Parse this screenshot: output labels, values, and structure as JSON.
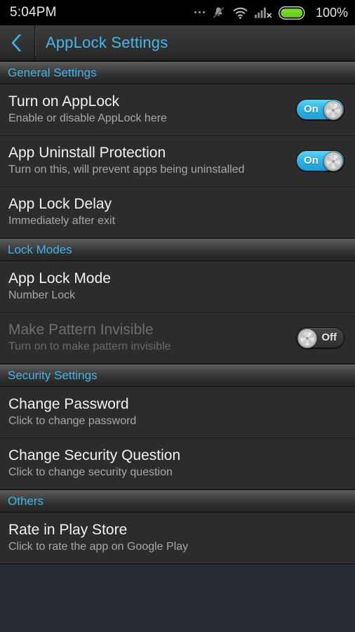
{
  "status_bar": {
    "time": "5:04PM",
    "overflow_dots": "...",
    "icons": [
      "vibrate-off-icon",
      "wifi-icon",
      "signal-no-service-icon",
      "battery-icon"
    ],
    "battery_percent": "100%",
    "battery_color": "#6ad020"
  },
  "title_bar": {
    "back_label": "‹",
    "title": "AppLock Settings",
    "accent_color": "#49b6e8"
  },
  "sections": [
    {
      "header": "General Settings",
      "rows": [
        {
          "title": "Turn on AppLock",
          "subtitle": "Enable or disable AppLock here",
          "control": "toggle",
          "toggle_state": "on",
          "toggle_label": "On",
          "disabled": false
        },
        {
          "title": "App Uninstall Protection",
          "subtitle": "Turn on this, will prevent apps being uninstalled",
          "control": "toggle",
          "toggle_state": "on",
          "toggle_label": "On",
          "disabled": false
        },
        {
          "title": "App Lock Delay",
          "subtitle": "Immediately after exit",
          "control": "none",
          "disabled": false
        }
      ]
    },
    {
      "header": "Lock Modes",
      "rows": [
        {
          "title": "App Lock Mode",
          "subtitle": "Number Lock",
          "control": "none",
          "disabled": false
        },
        {
          "title": "Make Pattern Invisible",
          "subtitle": "Turn on to make pattern invisible",
          "control": "toggle",
          "toggle_state": "off",
          "toggle_label": "Off",
          "disabled": true
        }
      ]
    },
    {
      "header": "Security Settings",
      "rows": [
        {
          "title": "Change Password",
          "subtitle": "Click to change password",
          "control": "none",
          "disabled": false
        },
        {
          "title": "Change Security Question",
          "subtitle": "Click to change security question",
          "control": "none",
          "disabled": false
        }
      ]
    },
    {
      "header": "Others",
      "rows": [
        {
          "title": "Rate in Play Store",
          "subtitle": "Click to rate the app on Google Play",
          "control": "none",
          "disabled": false
        }
      ]
    }
  ]
}
